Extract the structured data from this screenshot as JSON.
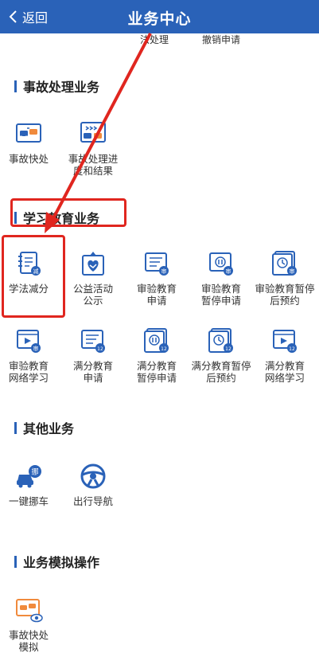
{
  "header": {
    "back_label": "返回",
    "title": "业务中心"
  },
  "top_partial": {
    "item1": "法处理",
    "item2": "撤销申请"
  },
  "accident": {
    "title": "事故处理业务",
    "items": [
      {
        "label": "事故快处",
        "icon": "accident-quick-icon"
      },
      {
        "label": "事故处理进度和结果",
        "icon": "accident-progress-icon"
      }
    ]
  },
  "study": {
    "title": "学习教育业务",
    "items": [
      {
        "label": "学法减分",
        "icon": "study-law-icon"
      },
      {
        "label": "公益活动公示",
        "icon": "public-welfare-icon"
      },
      {
        "label": "审验教育申请",
        "icon": "review-edu-apply-icon"
      },
      {
        "label": "审验教育暂停申请",
        "icon": "review-edu-pause-icon"
      },
      {
        "label": "审验教育暂停后预约",
        "icon": "review-edu-appointment-icon"
      },
      {
        "label": "审验教育网络学习",
        "icon": "review-edu-online-icon"
      },
      {
        "label": "满分教育申请",
        "icon": "full-score-apply-icon"
      },
      {
        "label": "满分教育暂停申请",
        "icon": "full-score-pause-icon"
      },
      {
        "label": "满分教育暂停后预约",
        "icon": "full-score-appointment-icon"
      },
      {
        "label": "满分教育网络学习",
        "icon": "full-score-online-icon"
      }
    ]
  },
  "other": {
    "title": "其他业务",
    "items": [
      {
        "label": "一键挪车",
        "icon": "move-car-icon"
      },
      {
        "label": "出行导航",
        "icon": "navigation-icon"
      }
    ]
  },
  "simulation": {
    "title": "业务模拟操作",
    "items": [
      {
        "label": "事故快处模拟",
        "icon": "accident-sim-icon"
      }
    ]
  },
  "badges": {
    "review": "审",
    "twelve": "12",
    "reduce": "减"
  },
  "colors": {
    "brand": "#2a62b8",
    "highlight": "#e0261f",
    "accent": "#f08a3c"
  }
}
